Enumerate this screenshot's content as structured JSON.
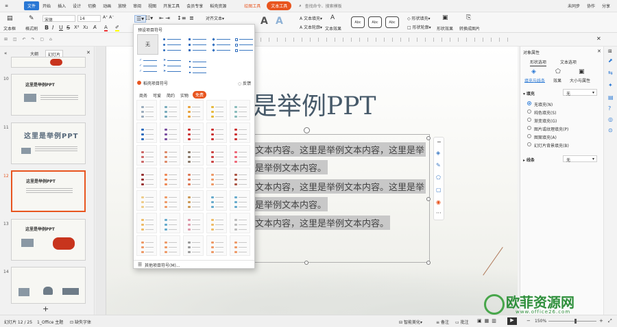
{
  "menu": [
    "文件",
    "开始",
    "插入",
    "设计",
    "切换",
    "动画",
    "放映",
    "审阅",
    "视图",
    "开发工具",
    "会员专享",
    "稻壳资源"
  ],
  "menu_context": [
    "绘图工具",
    "文本工具"
  ],
  "search_label": "查找命令、搜索模板",
  "account": [
    "未同步",
    "协作",
    "分享"
  ],
  "ribbon": {
    "textbox": "文本框",
    "format_painter": "格式刷",
    "font_name": "宋体",
    "font_size": "14",
    "align_text": "对齐文本",
    "text_fill": "文本填充",
    "text_outline": "文本轮廓",
    "text_effect": "文本效果",
    "style_box": "Abc",
    "shape_fill": "形状填充",
    "shape_outline": "形状轮廓",
    "shape_effect": "形状效果",
    "convert_pic": "转换成图片",
    "font_letters": [
      "A",
      "A"
    ]
  },
  "left_tabs": [
    "大纲",
    "幻灯片"
  ],
  "slides": [
    {
      "num": "10",
      "title": "这里是举例PPT"
    },
    {
      "num": "11",
      "title": "这里是举例PPT"
    },
    {
      "num": "12",
      "title": "这里是举例PPT"
    },
    {
      "num": "13",
      "title": "这里是举例PPT"
    },
    {
      "num": "14",
      "title": ""
    }
  ],
  "add_slide": "+",
  "editor": {
    "title": "是举例PPT",
    "lines": [
      "文本内容。这里是举例文本内容，这里是举",
      "是举例文本内容。",
      "文本内容，这里是举例文本内容。这里是举",
      "是举例文本内容。",
      "文本内容，这里是举例文本内容。"
    ]
  },
  "popup": {
    "header": "预设项目符号",
    "none": "无",
    "section": "稻壳项目符号",
    "feedback": "反馈",
    "tabs": [
      "商务",
      "可爱",
      "简约",
      "实物",
      "免费"
    ],
    "footer": "其他项目符号(M)..."
  },
  "right_panel": {
    "title": "对象属性",
    "tabs": [
      "形状选项",
      "文本选项"
    ],
    "subtabs": [
      "填充与线条",
      "效果",
      "大小与属性"
    ],
    "fill_label": "填充",
    "fill_value": "无",
    "options": [
      "无填充(N)",
      "纯色填充(S)",
      "渐变填充(G)",
      "图片或纹理填充(P)",
      "图案填充(A)",
      "幻灯片背景填充(B)"
    ],
    "line_label": "线条",
    "line_value": "无"
  },
  "status": {
    "slide_info": "幻灯片 12 / 25",
    "theme": "1_Office 主题",
    "font_missing": "缺失字体",
    "smart_beautify": "智能美化",
    "notes": "备注",
    "comments": "批注",
    "zoom": "150%"
  },
  "watermark": {
    "name": "欧菲资源网",
    "url": "www.office26.com"
  },
  "colors": {
    "accent": "#e8551f",
    "blue": "#2a78d4"
  }
}
